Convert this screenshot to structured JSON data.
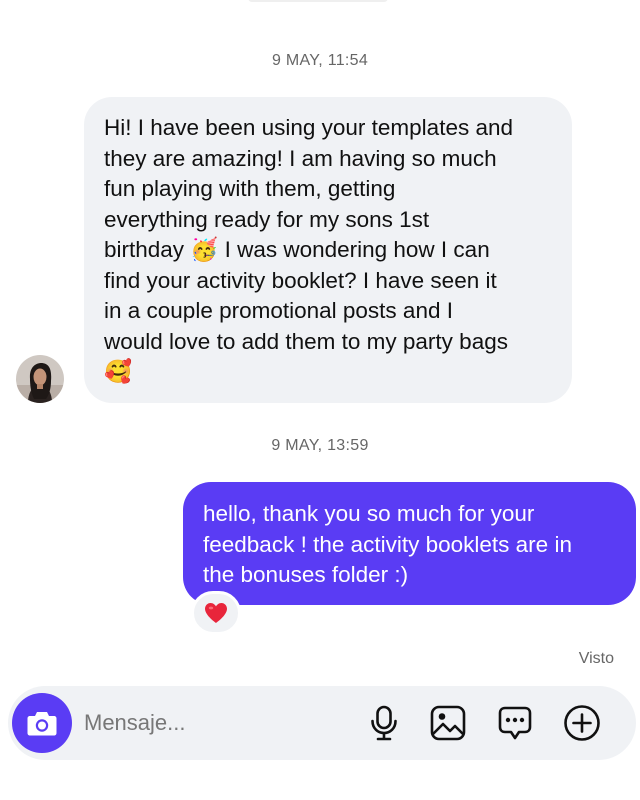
{
  "conversation": {
    "timestamp_1": "9 MAY, 11:54",
    "incoming_message": {
      "lines": [
        "Hi! I have been using your templates and",
        "they are amazing! I am having so much",
        "fun playing with them, getting",
        "everything ready for my sons 1st",
        "birthday 🥳 I was wondering how I can",
        "find your activity booklet? I have seen it",
        "in a couple promotional posts and I",
        "would love to add them to my party bags",
        "🥰"
      ]
    },
    "timestamp_2": "9 MAY, 13:59",
    "outgoing_message": {
      "lines": [
        "hello, thank you so much for your",
        "feedback ! the activity booklets are in",
        "the bonuses folder :)"
      ],
      "reaction": "❤️"
    },
    "seen_status": "Visto"
  },
  "composer": {
    "placeholder": "Mensaje...",
    "value": "",
    "icons": [
      "camera-icon",
      "microphone-icon",
      "image-icon",
      "sticker-icon",
      "plus-icon"
    ]
  },
  "colors": {
    "accent": "#5a3cf4",
    "incoming_bubble": "#f0f2f5",
    "composer_background": "#f0f2f5",
    "timestamp_text": "#666666"
  }
}
